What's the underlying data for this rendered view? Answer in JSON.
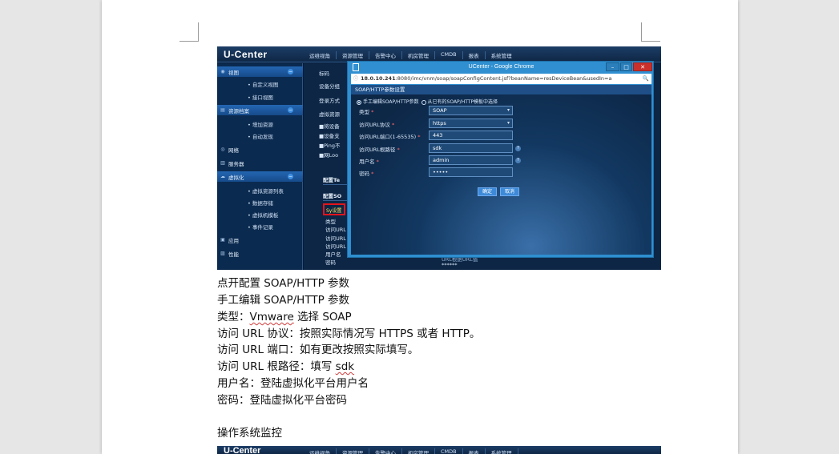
{
  "screenshot": {
    "logo": "U-Center",
    "nav": [
      "运维视角",
      "资源管理",
      "告警中心",
      "机房管理",
      "CMDB",
      "报表",
      "系统管理"
    ],
    "sidebar": [
      {
        "label": "视图",
        "group": true,
        "icon": "eye-icon"
      },
      {
        "label": "• 自定义视图",
        "group": false
      },
      {
        "label": "• 接口视图",
        "group": false
      },
      {
        "label": "资源档案",
        "group": true,
        "icon": "archive-icon"
      },
      {
        "label": "• 增加资源",
        "group": false
      },
      {
        "label": "• 自动发现",
        "group": false
      },
      {
        "label": "网络",
        "group": false,
        "icon": "globe-icon"
      },
      {
        "label": "服务器",
        "group": false,
        "icon": "server-icon"
      },
      {
        "label": "虚拟化",
        "group": true,
        "icon": "cloud-icon"
      },
      {
        "label": "• 虚拟资源列表",
        "group": false
      },
      {
        "label": "• 数据存储",
        "group": false
      },
      {
        "label": "• 虚拟机模板",
        "group": false
      },
      {
        "label": "• 事件记录",
        "group": false
      },
      {
        "label": "应用",
        "group": false,
        "icon": "app-icon"
      },
      {
        "label": "性能",
        "group": false,
        "icon": "chart-icon"
      }
    ],
    "main_labels": [
      "标码",
      "设备分组",
      "登录方式",
      "虚拟资源",
      "■将设备",
      "■设备支",
      "■Ping不",
      "■网Loo"
    ],
    "section1": "配置Te",
    "section2": "配置SO",
    "highlighted_link": "Sy设置",
    "lower_labels": [
      "类型",
      "访问URL",
      "访问URL",
      "访问URL",
      "用户名",
      "密码"
    ],
    "lower_password": "******",
    "lower_url_fragment": "URL根据URL值",
    "popup": {
      "title": "UCenter - Google Chrome",
      "btn_min": "–",
      "btn_max": "□",
      "btn_close": "✕",
      "url_host": "18.0.10.241",
      "url_rest": ":8080/imc/vnm/soap/soapConfigContent.jsf?beanName=resDeviceBean&usedIn=a",
      "header": "SOAP/HTTP参数设置",
      "radio1": "手工编辑SOAP/HTTP参数",
      "radio2": "从已有的SOAP/HTTP模板中选择",
      "fields": [
        {
          "label": "类型",
          "value": "SOAP",
          "select": true,
          "hint": false
        },
        {
          "label": "访问URL协议",
          "value": "https",
          "select": true,
          "hint": false
        },
        {
          "label": "访问URL端口(1-65535)",
          "value": "443",
          "select": false,
          "hint": false
        },
        {
          "label": "访问URL根路径",
          "value": "sdk",
          "select": false,
          "hint": true
        },
        {
          "label": "用户名",
          "value": "admin",
          "select": false,
          "hint": true
        },
        {
          "label": "密码",
          "value": "•••••",
          "select": false,
          "hint": false
        }
      ],
      "ok": "确定",
      "cancel": "取消"
    }
  },
  "text": {
    "line1": "点开配置 SOAP/HTTP 参数",
    "line2": "手工编辑 SOAP/HTTP 参数",
    "line3_a": "类型：",
    "line3_b": "Vmware",
    "line3_c": " 选择 SOAP",
    "line4": "访问 URL 协议：按照实际情况写 HTTPS 或者 HTTP。",
    "line5": "访问 URL 端口：如有更改按照实际填写。",
    "line6_a": "访问 URL 根路径：填写 ",
    "line6_b": "sdk",
    "line7": "用户名：登陆虚拟化平台用户名",
    "line8": "密码：登陆虚拟化平台密码",
    "heading": "操作系统监控"
  },
  "screenshot2": {
    "logo": "U-Center",
    "nav": [
      "运维视角",
      "资源管理",
      "告警中心",
      "机房管理",
      "CMDB",
      "报表",
      "系统管理"
    ]
  }
}
